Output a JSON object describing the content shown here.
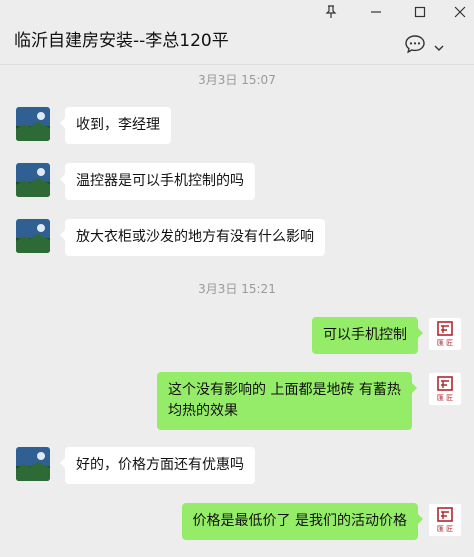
{
  "window": {
    "title": "临沂自建房安装--李总120平",
    "pin_icon": "pin-icon",
    "minimize_icon": "minimize-icon",
    "maximize_icon": "maximize-icon",
    "close_icon": "close-icon"
  },
  "toolbar": {
    "chat_icon": "chat-bubble-icon",
    "more_icon": "chevron-down-icon"
  },
  "timestamps": [
    "3月3日 15:07",
    "3月3日 15:21"
  ],
  "messages": [
    {
      "side": "in",
      "text": "收到，李经理"
    },
    {
      "side": "in",
      "text": "温控器是可以手机控制的吗"
    },
    {
      "side": "in",
      "text": "放大衣柜或沙发的地方有没有什么影响"
    },
    {
      "side": "out",
      "text": "可以手机控制"
    },
    {
      "side": "out",
      "text": "这个没有影响的 上面都是地砖 有蓄热均热的效果"
    },
    {
      "side": "in",
      "text": "好的，价格方面还有优惠吗"
    },
    {
      "side": "out",
      "text": "价格是最低价了 是我们的活动价格"
    }
  ],
  "brand_logo_text": "匯 匠",
  "colors": {
    "background": "#ededed",
    "incoming_bubble": "#ffffff",
    "outgoing_bubble": "#95ec69",
    "logo_red": "#b3262e"
  }
}
